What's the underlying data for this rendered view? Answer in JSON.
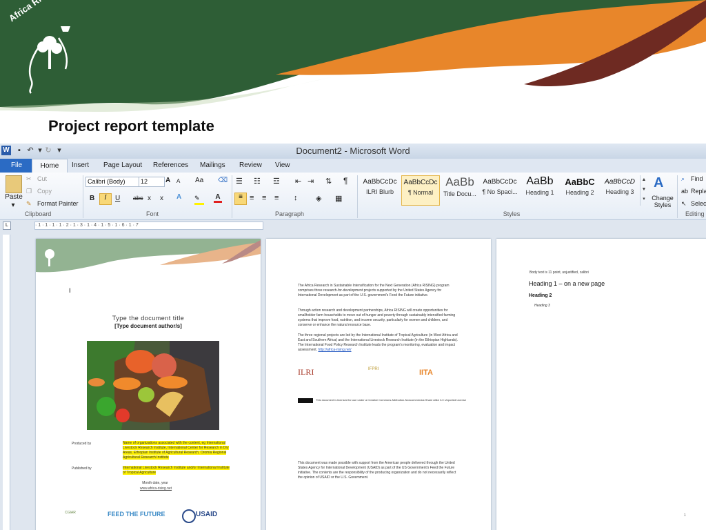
{
  "slide": {
    "title": "Project report template",
    "logo_text": "Africa RISING"
  },
  "word": {
    "window_title": "Document2 - Microsoft Word",
    "app_icon": "W",
    "tabs": [
      "File",
      "Home",
      "Insert",
      "Page Layout",
      "References",
      "Mailings",
      "Review",
      "View"
    ],
    "clipboard": {
      "paste": "Paste",
      "cut": "Cut",
      "copy": "Copy",
      "format_painter": "Format Painter",
      "label": "Clipboard"
    },
    "font": {
      "name": "Calibri (Body)",
      "size": "12",
      "label": "Font",
      "grow": "A",
      "shrink": "A",
      "case": "Aa",
      "bold": "B",
      "italic": "I",
      "underline": "U",
      "strike": "abc",
      "subscript": "x",
      "superscript": "x"
    },
    "paragraph": {
      "label": "Paragraph",
      "pilcrow": "¶"
    },
    "styles": {
      "label": "Styles",
      "items": [
        {
          "sample": "AaBbCcDc",
          "name": "ILRI Blurb"
        },
        {
          "sample": "AaBbCcDc",
          "name": "¶ Normal"
        },
        {
          "sample": "AaBb",
          "name": "Title Docu..."
        },
        {
          "sample": "AaBbCcDc",
          "name": "¶ No Spaci..."
        },
        {
          "sample": "AaBb",
          "name": "Heading 1"
        },
        {
          "sample": "AaBbC",
          "name": "Heading 2"
        },
        {
          "sample": "AaBbCcD",
          "name": "Heading 3"
        }
      ],
      "change_styles": "Change Styles"
    },
    "editing": {
      "label": "Editing",
      "find": "Find",
      "replace": "Repla",
      "select": "Selec"
    },
    "ruler": "· 1 · 1 · 1 · 1 · 2 · 1 · 3 · 1 · 4 · 1 · 5 · 1 · 6 · 1 · 7",
    "page1": {
      "doc_title": "Type the document title",
      "author": "[Type document author/s]",
      "produced_by_label": "Produced by",
      "produced_by_value": "Name of organizations associated with the content, eg International Livestock Research Institute, International Center for Research in Dry Areas, Ethiopian Institute of Agricultural Research, Oromia Regional Agricultural Research Institute",
      "published_by_label": "Published by",
      "published_by_value": "International Livestock Research Institute and/or International Institute of Tropical Agriculture",
      "date": "Month date, year",
      "url": "www.africa-rising.net",
      "logos": [
        "CGIAR",
        "FEED THE FUTURE",
        "USAID"
      ]
    },
    "page2": {
      "para1": "The Africa Research in Sustainable Intensification for the Next Generation (Africa RISING) program comprises three research-for-development projects supported by the United States Agency for International Development as part of the U.S. government's Feed the Future initiative.",
      "para2": "Through action research and development partnerships, Africa RISING will create opportunities for smallholder farm households to move out of hunger and poverty through sustainably intensified farming systems that improve food, nutrition, and income security, particularly for women and children, and conserve or enhance the natural resource base.",
      "para3": "The three regional projects are led by the International Institute of Tropical Agriculture (in West Africa and East and Southern Africa) and the International Livestock Research Institute (in the Ethiopian Highlands). The International Food Policy Research Institute leads the program's monitoring, evaluation and impact assessment.",
      "link": "http://africa-rising.net/",
      "logos": [
        "ILRI",
        "IFPRI",
        "IITA"
      ],
      "license": "This document is licensed for use under a Creative Commons Attribution-Noncommercial-Share Alike 3.0 Unported License",
      "footer": "This document was made possible with support from the American people delivered through the United States Agency for International Development (USAID) as part of the US Government's Feed the Future initiative. The contents are the responsibility of the producing organization and do not necessarily reflect the opinion of USAID or the U.S. Government."
    },
    "page3": {
      "body_note": "Body text is 11 point, unjustified, calibri",
      "heading1": "Heading 1 – on a new page",
      "heading2": "Heading 2",
      "heading3": "Heading 3",
      "page_number": "1"
    }
  },
  "colors": {
    "header_green": "#2e5e36",
    "header_orange": "#e8862a",
    "header_brown": "#6e2a22",
    "word_blue": "#2b6bc4",
    "highlight": "#fff200"
  }
}
